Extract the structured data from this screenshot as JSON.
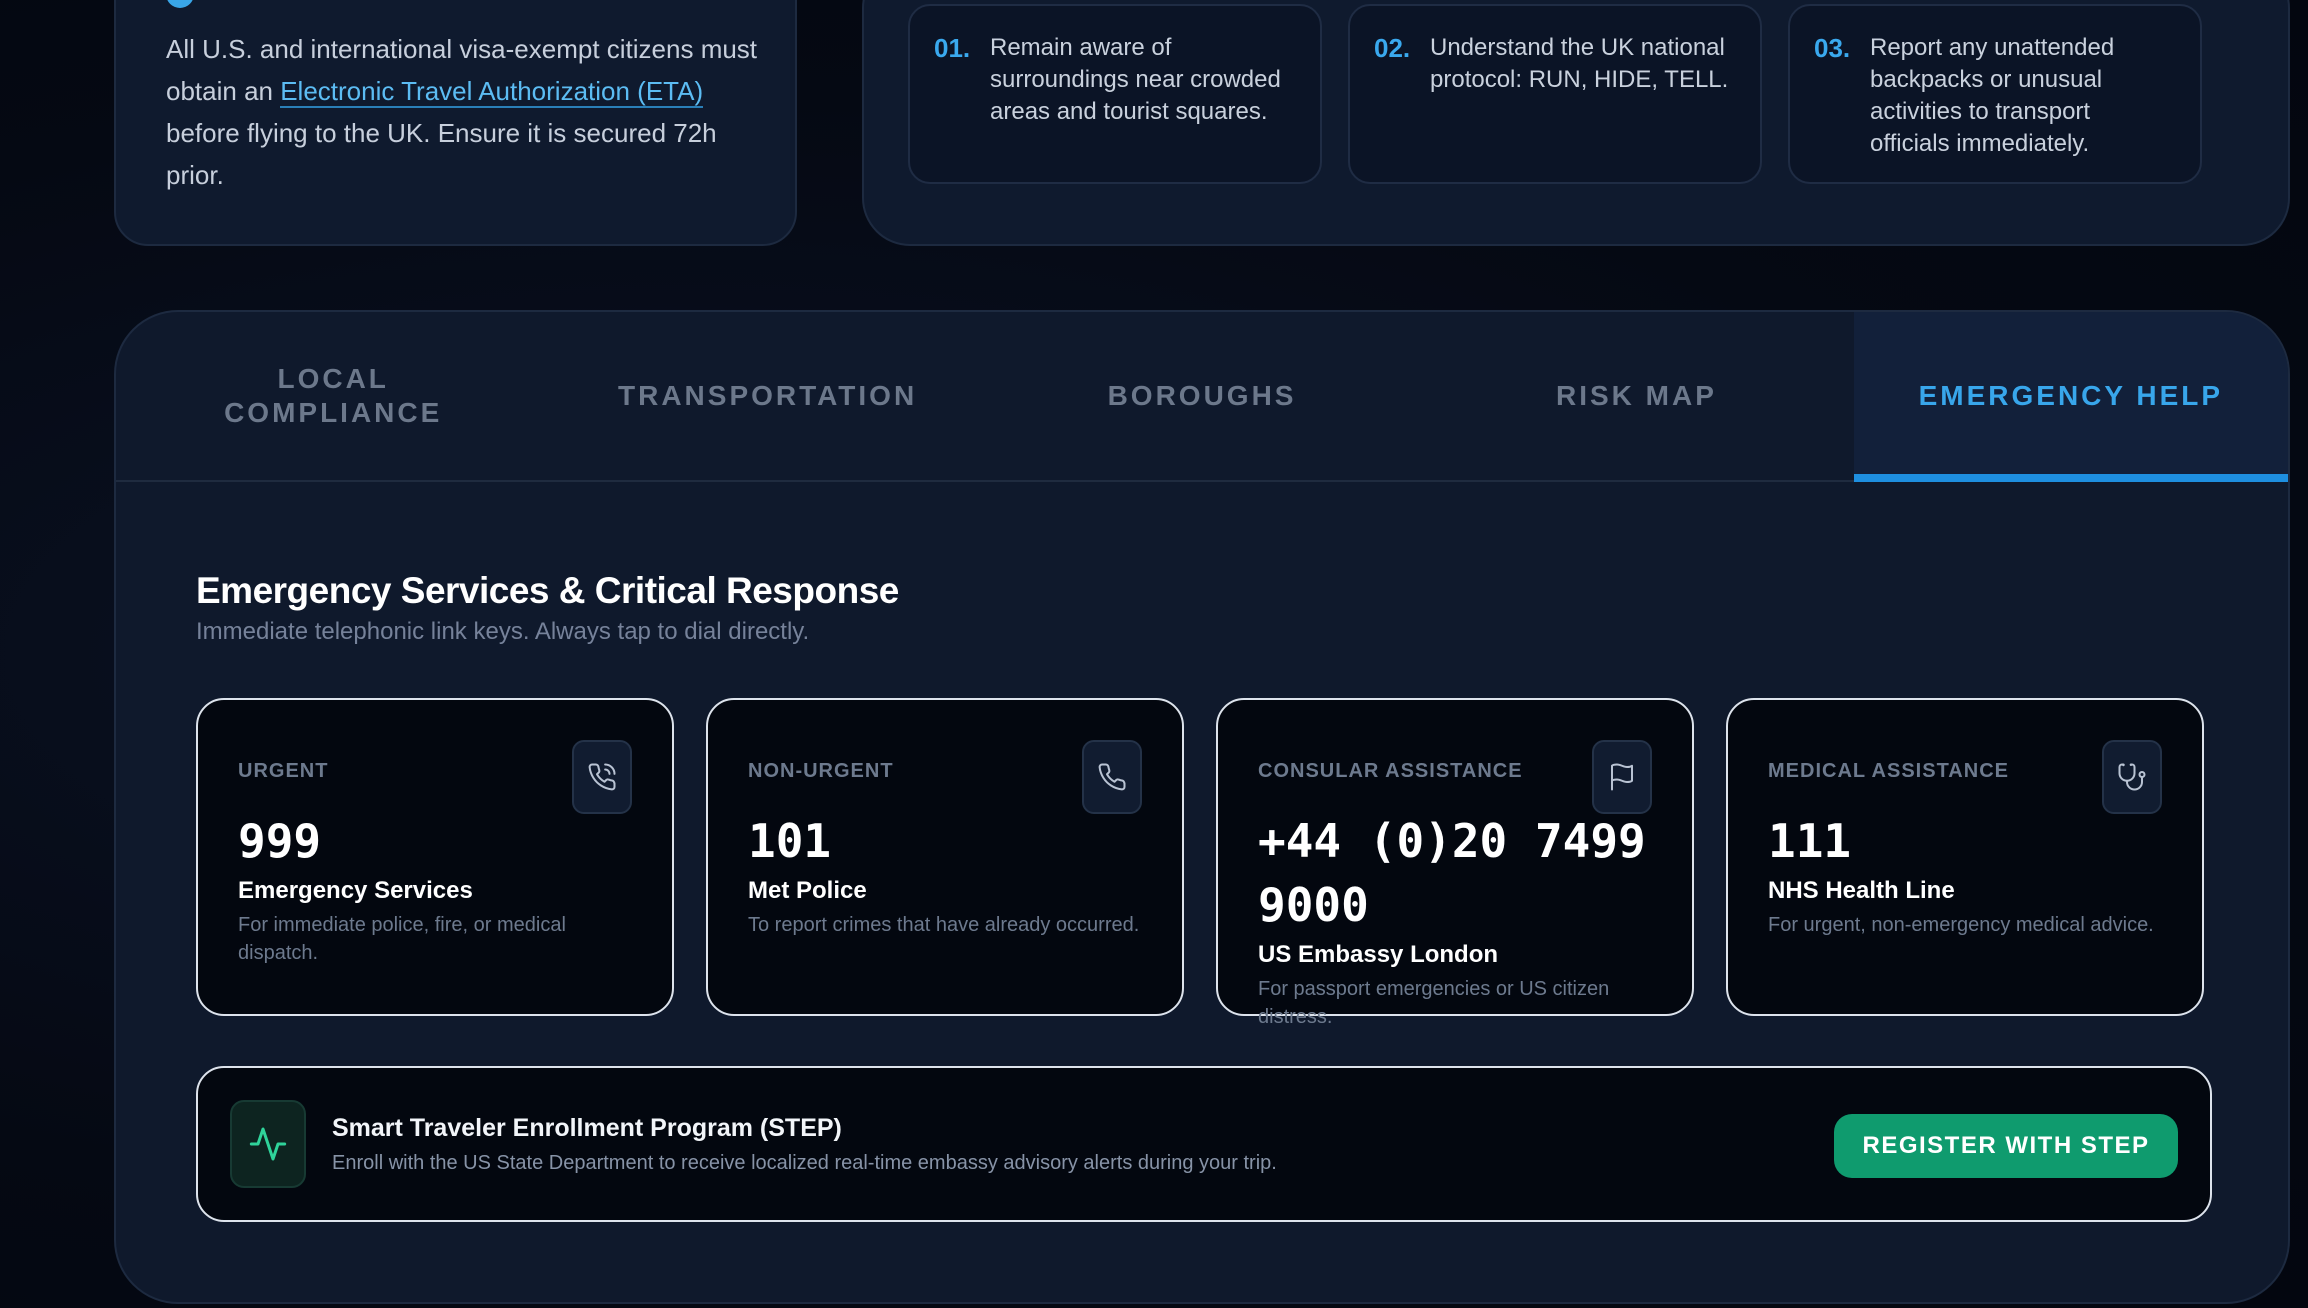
{
  "visa": {
    "text_before": "All U.S. and international visa-exempt citizens must obtain an ",
    "link": "Electronic Travel Authorization (ETA)",
    "text_after": " before flying to the UK. Ensure it is secured 72h prior."
  },
  "protocol_steps": [
    {
      "num": "01.",
      "text": "Remain aware of surroundings near crowded areas and tourist squares."
    },
    {
      "num": "02.",
      "text": "Understand the UK national protocol: RUN, HIDE, TELL."
    },
    {
      "num": "03.",
      "text": "Report any unattended backpacks or unusual activities to transport officials immediately."
    }
  ],
  "tabs": [
    {
      "label": "LOCAL COMPLIANCE",
      "active": false
    },
    {
      "label": "TRANSPORTATION",
      "active": false
    },
    {
      "label": "BOROUGHS",
      "active": false
    },
    {
      "label": "RISK MAP",
      "active": false
    },
    {
      "label": "EMERGENCY HELP",
      "active": true
    }
  ],
  "emergency": {
    "title": "Emergency Services & Critical Response",
    "subtitle": "Immediate telephonic link keys. Always tap to dial directly.",
    "cards": [
      {
        "category": "URGENT",
        "number": "999",
        "name": "Emergency Services",
        "desc": "For immediate police, fire, or medical dispatch.",
        "icon": "phone-call-icon"
      },
      {
        "category": "NON-URGENT",
        "number": "101",
        "name": "Met Police",
        "desc": "To report crimes that have already occurred.",
        "icon": "phone-icon"
      },
      {
        "category": "CONSULAR ASSISTANCE",
        "number": "+44 (0)20 7499 9000",
        "name": "US Embassy London",
        "desc": "For passport emergencies or US citizen distress.",
        "icon": "flag-icon"
      },
      {
        "category": "MEDICAL ASSISTANCE",
        "number": "111",
        "name": "NHS Health Line",
        "desc": "For urgent, non-emergency medical advice.",
        "icon": "stethoscope-icon"
      }
    ]
  },
  "step_banner": {
    "title": "Smart Traveler Enrollment Program (STEP)",
    "desc": "Enroll with the US State Department to receive localized real-time embassy advisory alerts during your trip.",
    "button": "REGISTER WITH STEP",
    "icon": "activity-pulse-icon"
  },
  "colors": {
    "accent_blue": "#38a6eb",
    "button_green": "#0f9b6e",
    "background": "#060b18"
  }
}
